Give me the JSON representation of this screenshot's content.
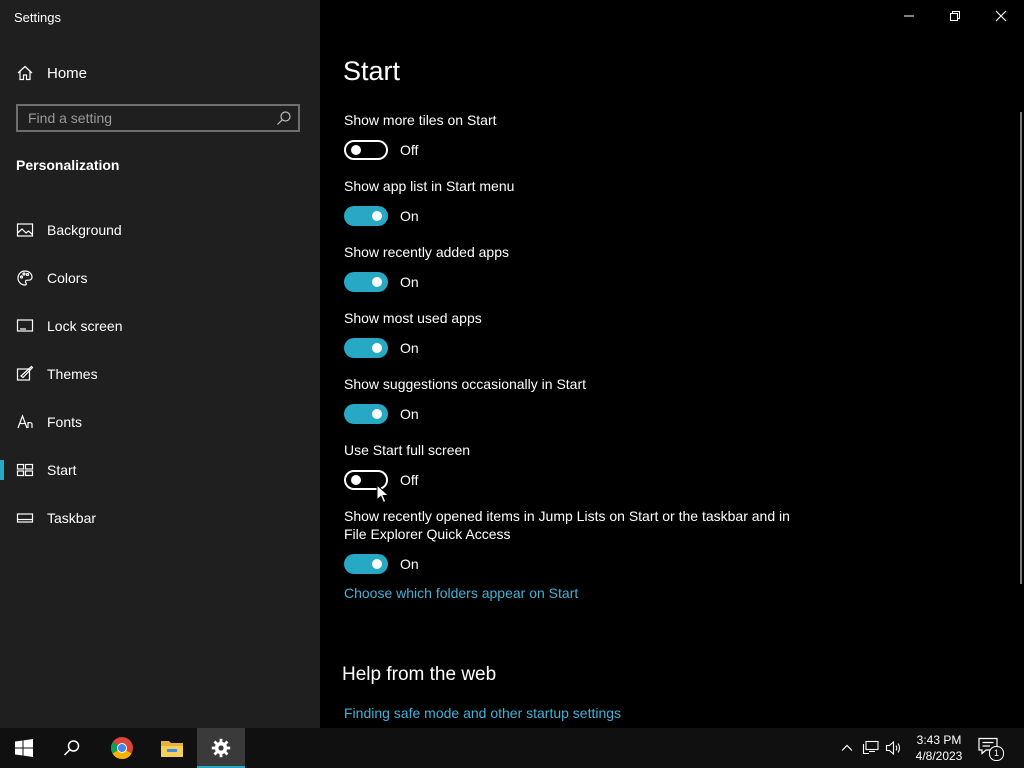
{
  "window": {
    "title": "Settings"
  },
  "sidebar": {
    "home_label": "Home",
    "search_placeholder": "Find a setting",
    "section_title": "Personalization",
    "items": [
      {
        "label": "Background",
        "icon": "image-icon"
      },
      {
        "label": "Colors",
        "icon": "palette-icon"
      },
      {
        "label": "Lock screen",
        "icon": "lock-screen-icon"
      },
      {
        "label": "Themes",
        "icon": "themes-icon"
      },
      {
        "label": "Fonts",
        "icon": "fonts-icon"
      },
      {
        "label": "Start",
        "icon": "start-icon",
        "active": true
      },
      {
        "label": "Taskbar",
        "icon": "taskbar-icon"
      }
    ]
  },
  "main": {
    "title": "Start",
    "settings": [
      {
        "label": "Show more tiles on Start",
        "state": "Off",
        "on": false
      },
      {
        "label": "Show app list in Start menu",
        "state": "On",
        "on": true
      },
      {
        "label": "Show recently added apps",
        "state": "On",
        "on": true
      },
      {
        "label": "Show most used apps",
        "state": "On",
        "on": true
      },
      {
        "label": "Show suggestions occasionally in Start",
        "state": "On",
        "on": true
      },
      {
        "label": "Use Start full screen",
        "state": "Off",
        "on": false
      },
      {
        "label": "Show recently opened items in Jump Lists on Start or the taskbar and in File Explorer Quick Access",
        "state": "On",
        "on": true
      }
    ],
    "folders_link": "Choose which folders appear on Start",
    "help_title": "Help from the web",
    "help_link": "Finding safe mode and other startup settings"
  },
  "taskbar": {
    "time": "3:43 PM",
    "date": "4/8/2023",
    "notification_count": "1"
  },
  "colors": {
    "accent": "#27a8c5",
    "link": "#41b1d8",
    "sidebar_bg": "#1f1f1f"
  }
}
